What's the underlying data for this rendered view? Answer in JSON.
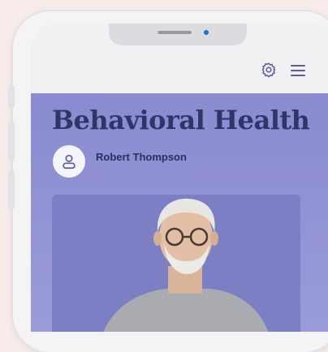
{
  "app": {
    "title": "Behavioral Health"
  },
  "user": {
    "name": "Robert Thompson"
  },
  "icons": {
    "settings": "gear-icon",
    "menu": "hamburger-icon",
    "avatar": "user-icon"
  },
  "photo": {
    "description_icon": "profile-photo"
  },
  "colors": {
    "page_background": "#f8ecea",
    "header_background": "#8a8bd0",
    "title_color": "#2f3566",
    "photo_background": "#7c7fc3"
  }
}
